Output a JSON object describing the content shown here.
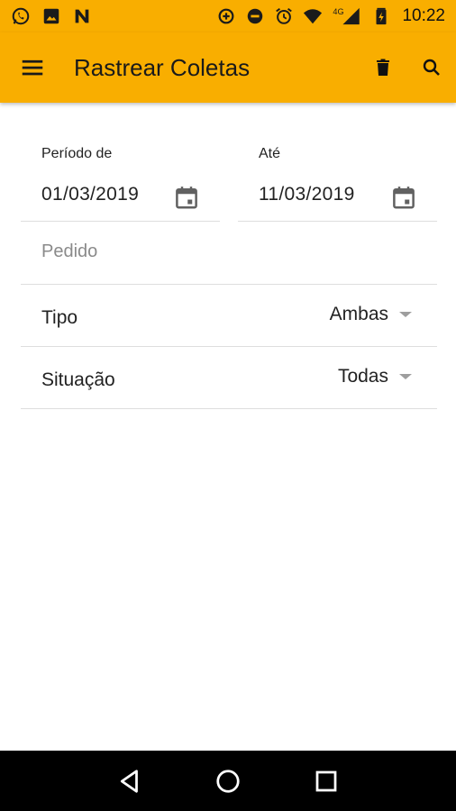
{
  "status_bar": {
    "time": "10:22",
    "network": "4G",
    "left_icons": [
      "whatsapp-icon",
      "image-icon",
      "n-app-icon"
    ],
    "right_icons": [
      "data-saver-icon",
      "do-not-disturb-icon",
      "alarm-icon",
      "wifi-icon",
      "signal-icon",
      "battery-icon"
    ]
  },
  "app_bar": {
    "title": "Rastrear Coletas",
    "background": "#F9AE00",
    "actions": [
      "delete-icon",
      "search-icon"
    ]
  },
  "form": {
    "period_from": {
      "label": "Período de",
      "value": "01/03/2019"
    },
    "period_to": {
      "label": "Até",
      "value": "11/03/2019"
    },
    "pedido": {
      "placeholder": "Pedido",
      "value": ""
    },
    "tipo": {
      "label": "Tipo",
      "value": "Ambas"
    },
    "situacao": {
      "label": "Situação",
      "value": "Todas"
    }
  },
  "nav_bar": {
    "buttons": [
      "back-icon",
      "home-icon",
      "recents-icon"
    ]
  }
}
